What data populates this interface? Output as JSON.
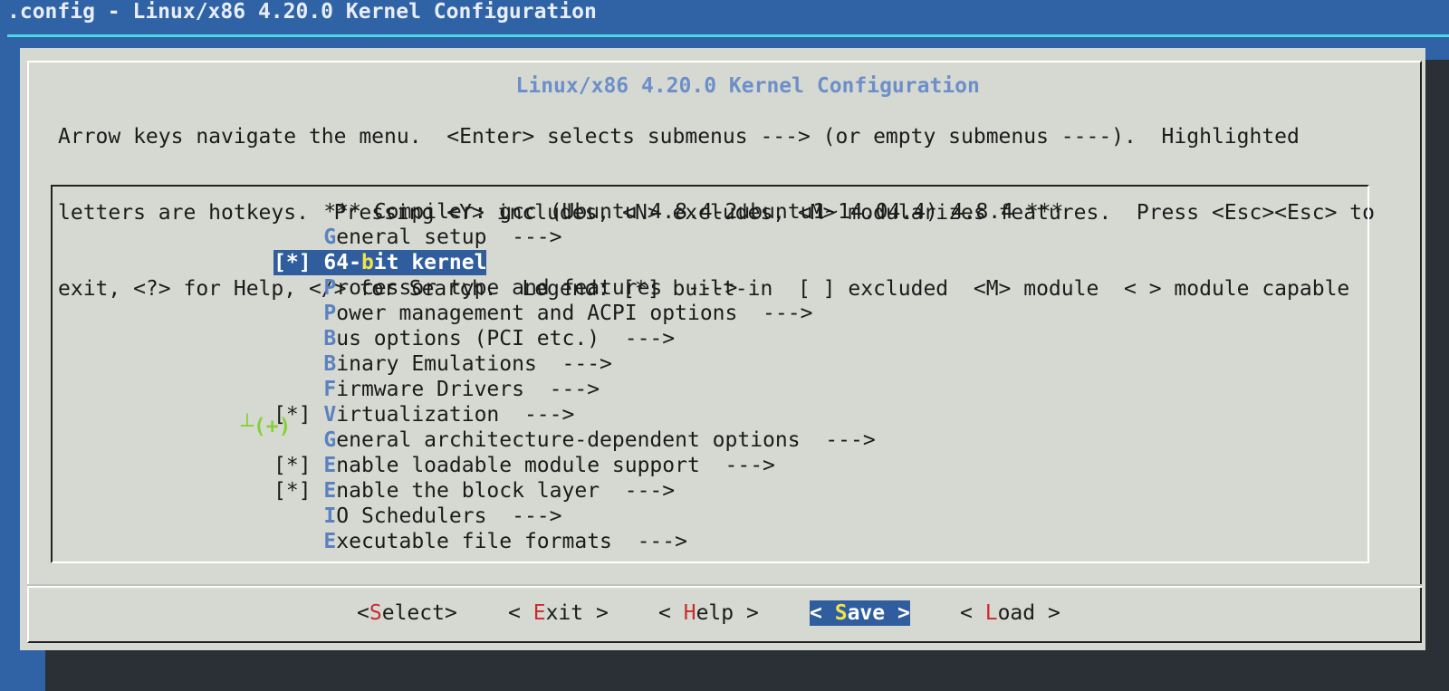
{
  "window": {
    "title": ".config - Linux/x86 4.20.0 Kernel Configuration"
  },
  "dialog": {
    "title": "Linux/x86 4.20.0 Kernel Configuration",
    "help_lines": [
      "Arrow keys navigate the menu.  <Enter> selects submenus ---> (or empty submenus ----).  Highlighted",
      "letters are hotkeys.  Pressing <Y> includes, <N> excludes, <M> modularizes features.  Press <Esc><Esc> to",
      "exit, <?> for Help, </> for Search.  Legend: [*] built-in  [ ] excluded  <M> module  < > module capable"
    ]
  },
  "menu": {
    "items": [
      {
        "prefix": "    ",
        "pre": "",
        "hotkey": "",
        "post": "*** Compiler: gcc (Ubuntu 4.8.4-2ubuntu1~14.04.4) 4.8.4 ***",
        "selected": false
      },
      {
        "prefix": "    ",
        "pre": "",
        "hotkey": "G",
        "post": "eneral setup  --->",
        "selected": false
      },
      {
        "prefix": "[*] ",
        "pre": "64-",
        "hotkey": "b",
        "post": "it kernel",
        "selected": true
      },
      {
        "prefix": "    ",
        "pre": "",
        "hotkey": "P",
        "post": "rocessor type and features  --->",
        "selected": false
      },
      {
        "prefix": "    ",
        "pre": "",
        "hotkey": "P",
        "post": "ower management and ACPI options  --->",
        "selected": false
      },
      {
        "prefix": "    ",
        "pre": "",
        "hotkey": "B",
        "post": "us options (PCI etc.)  --->",
        "selected": false
      },
      {
        "prefix": "    ",
        "pre": "",
        "hotkey": "B",
        "post": "inary Emulations  --->",
        "selected": false
      },
      {
        "prefix": "    ",
        "pre": "",
        "hotkey": "F",
        "post": "irmware Drivers  --->",
        "selected": false
      },
      {
        "prefix": "[*] ",
        "pre": "",
        "hotkey": "V",
        "post": "irtualization  --->",
        "selected": false
      },
      {
        "prefix": "    ",
        "pre": "",
        "hotkey": "G",
        "post": "eneral architecture-dependent options  --->",
        "selected": false
      },
      {
        "prefix": "[*] ",
        "pre": "",
        "hotkey": "E",
        "post": "nable loadable module support  --->",
        "selected": false
      },
      {
        "prefix": "[*] ",
        "pre": "",
        "hotkey": "E",
        "post": "nable the block layer  --->",
        "selected": false
      },
      {
        "prefix": "    ",
        "pre": "",
        "hotkey": "I",
        "post": "O Schedulers  --->",
        "selected": false
      },
      {
        "prefix": "    ",
        "pre": "",
        "hotkey": "E",
        "post": "xecutable file formats  --->",
        "selected": false
      }
    ],
    "more_indicator": "┴(+)"
  },
  "buttons": [
    {
      "id": "select",
      "open": "<",
      "hotkey": "S",
      "rest": "elect",
      "close": ">",
      "active": false
    },
    {
      "id": "exit",
      "open": "< ",
      "hotkey": "E",
      "rest": "xit",
      "close": " >",
      "active": false
    },
    {
      "id": "help",
      "open": "< ",
      "hotkey": "H",
      "rest": "elp",
      "close": " >",
      "active": false
    },
    {
      "id": "save",
      "open": "< ",
      "hotkey": "S",
      "rest": "ave",
      "close": " >",
      "active": true
    },
    {
      "id": "load",
      "open": "< ",
      "hotkey": "L",
      "rest": "oad",
      "close": " >",
      "active": false
    }
  ]
}
